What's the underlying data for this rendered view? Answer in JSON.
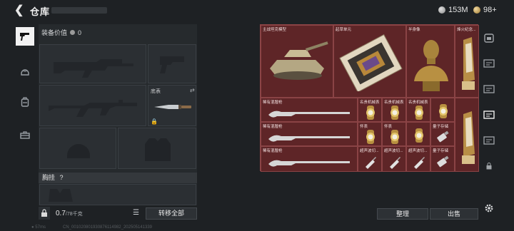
{
  "header": {
    "title": "仓库",
    "currency_main": "153M",
    "currency_secondary": "98+"
  },
  "equipment": {
    "value_label": "装备价值",
    "value": "0",
    "melee_label": "底表",
    "chest_label": "胸挂",
    "chest_help": "?",
    "weight": "0.7",
    "weight_max": "/78千克",
    "transfer_all": "转移全部"
  },
  "stash": {
    "items": [
      {
        "label": "主战坦克模型"
      },
      {
        "label": "起草单元"
      },
      {
        "label": "半身像"
      },
      {
        "label": "烽火纪念..."
      },
      {
        "label": "稀有混膛枪"
      },
      {
        "label": "名贵机械表"
      },
      {
        "label": "名贵机械表"
      },
      {
        "label": "名贵机械表"
      },
      {
        "label": "稀有混膛枪"
      },
      {
        "label": "怀表"
      },
      {
        "label": "怀表"
      },
      {
        "label": "量子存储"
      },
      {
        "label": "稀有混膛枪"
      },
      {
        "label": "超声波切..."
      },
      {
        "label": "超声波切..."
      },
      {
        "label": "超声波切..."
      },
      {
        "label": "量子存储"
      }
    ],
    "sort_button": "整理",
    "sell_button": "出售"
  },
  "footer": {
    "ping": "57ms",
    "session": "CN_001020801930876114982_202505141339"
  }
}
